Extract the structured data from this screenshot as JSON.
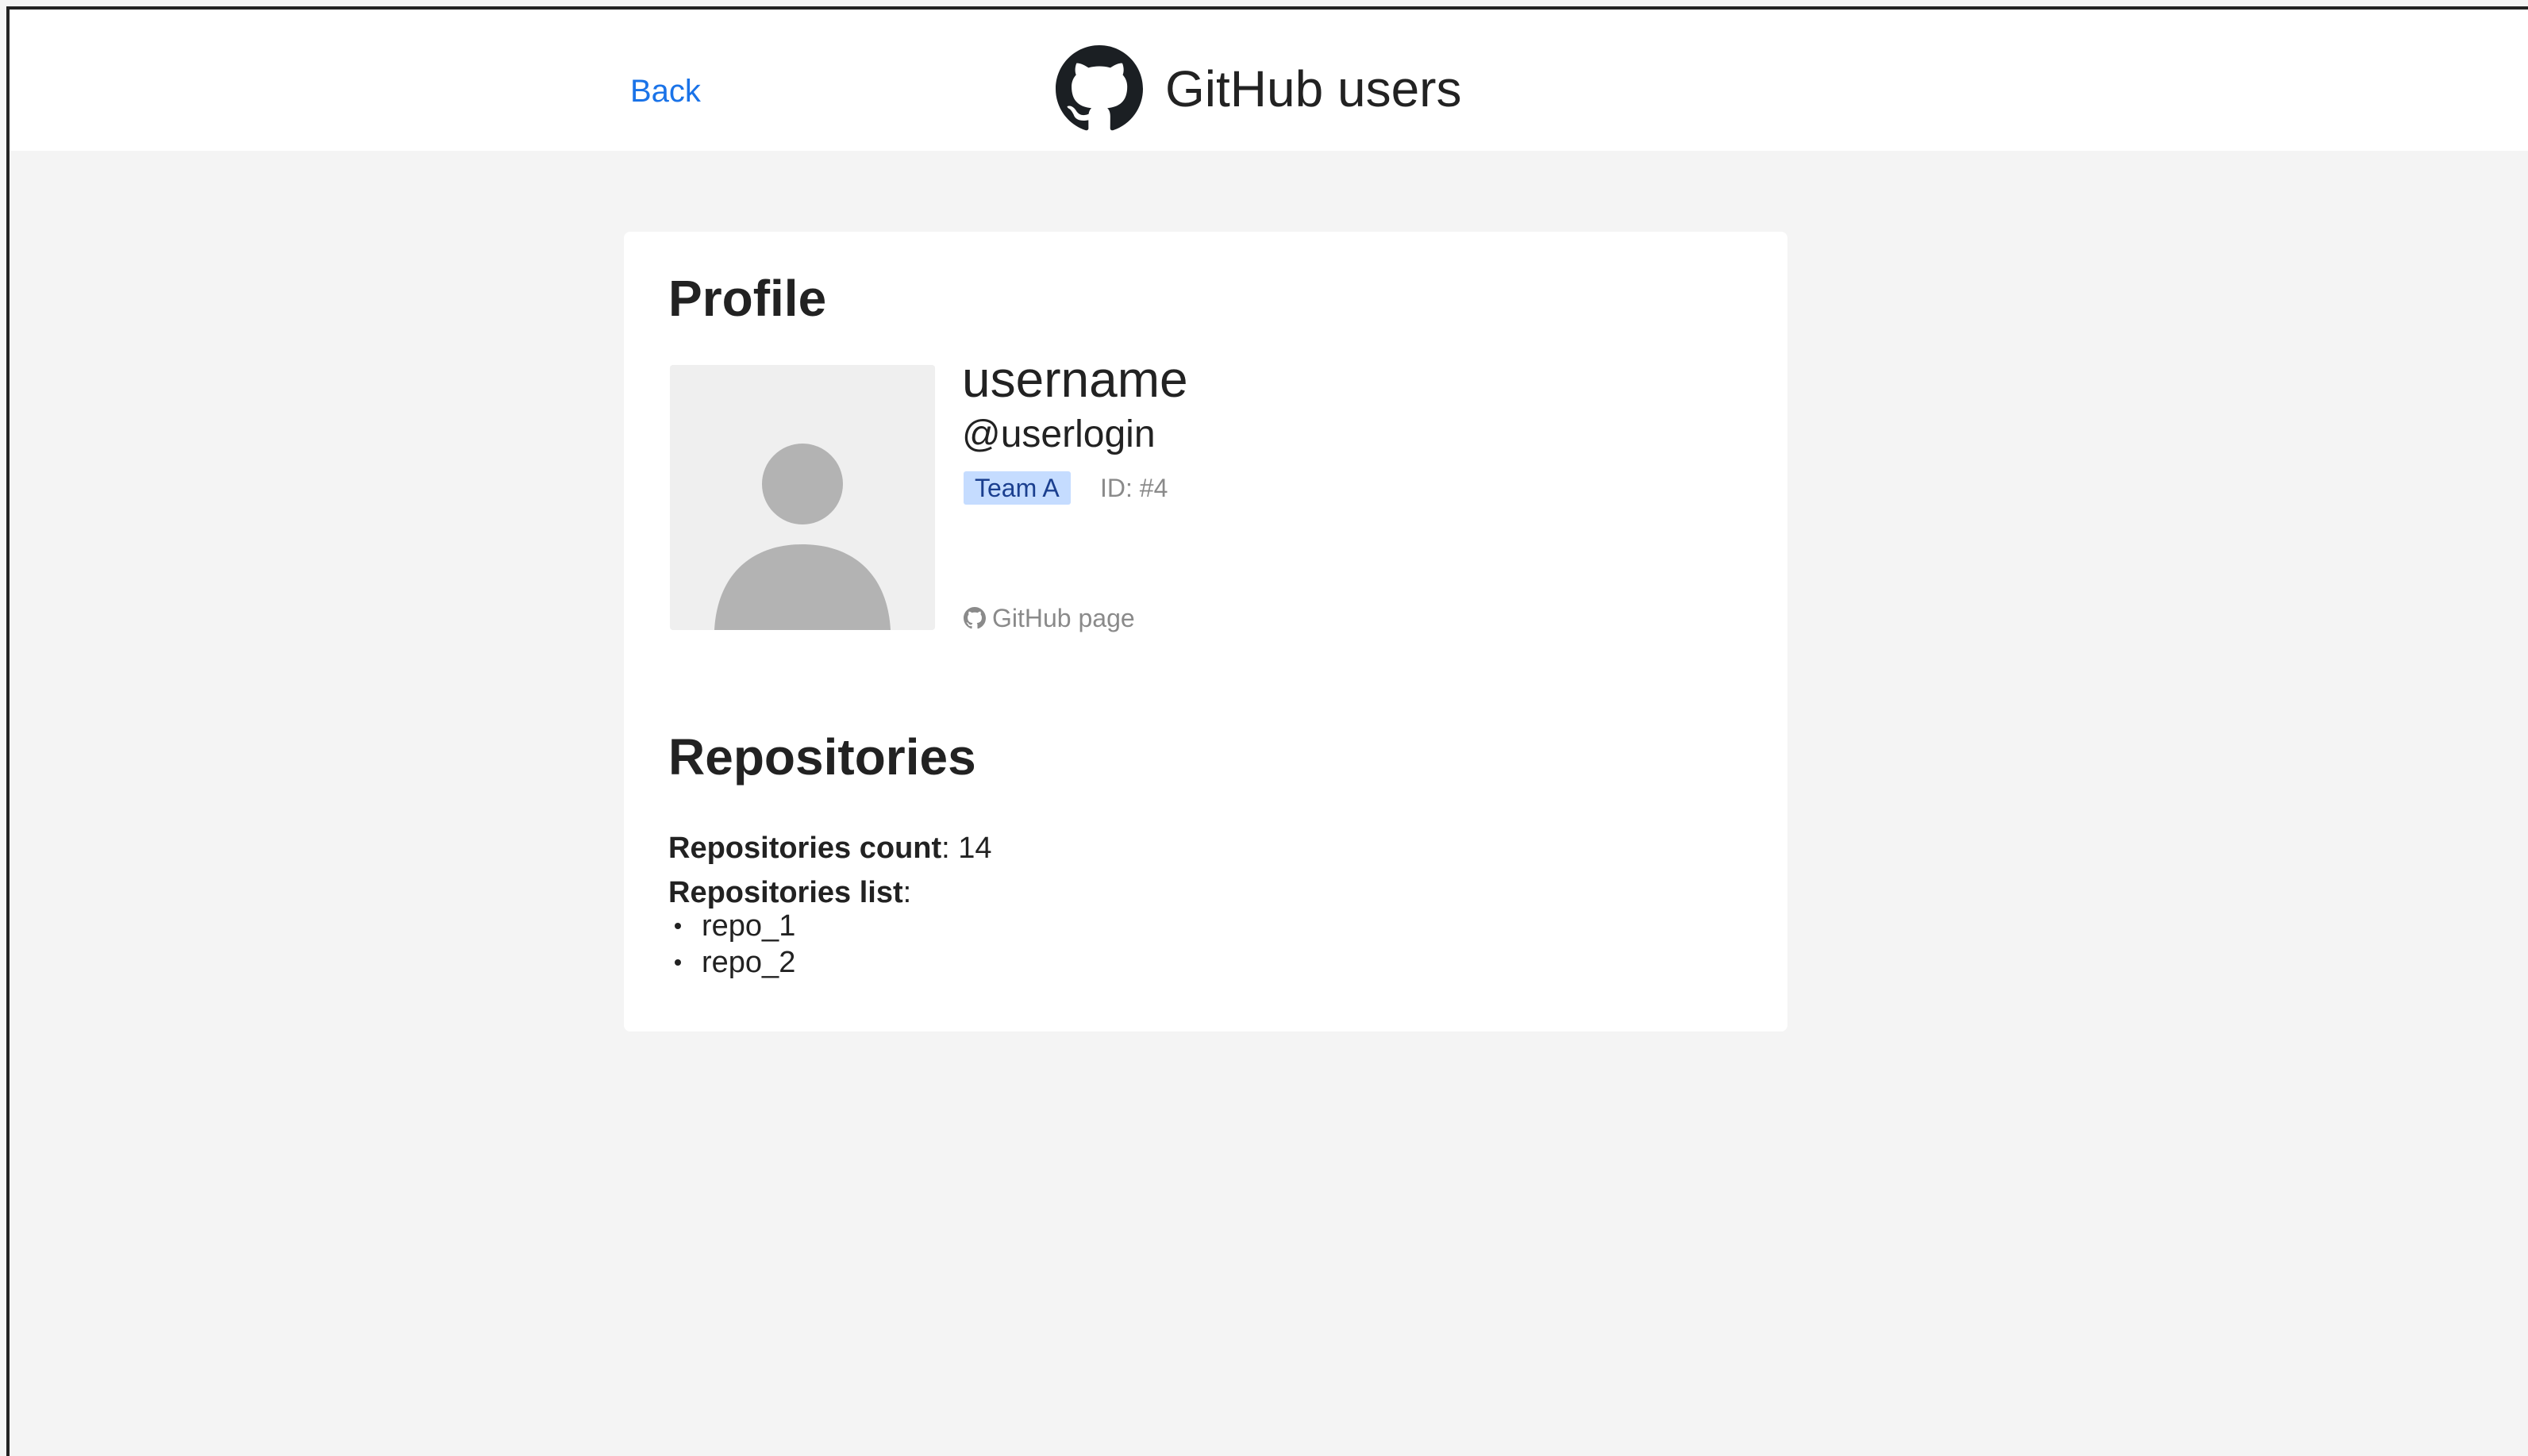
{
  "header": {
    "back_label": "Back",
    "title": "GitHub users",
    "logo_icon": "github-octocat-icon"
  },
  "profile": {
    "heading": "Profile",
    "avatar_icon": "default-user-avatar-icon",
    "name": "username",
    "login": "@userlogin",
    "team_badge": "Team A",
    "id_label": "ID: #4",
    "github_link_icon": "github-icon",
    "github_link_label": "GitHub page"
  },
  "repositories": {
    "heading": "Repositories",
    "count_label": "Repositories count",
    "count_value": "14",
    "list_label": "Repositories list",
    "items": [
      "repo_1",
      "repo_2"
    ]
  },
  "colors": {
    "link": "#1a73e8",
    "badge_bg": "#c5dcff",
    "badge_text": "#1b3f8f",
    "page_bg": "#f4f4f4"
  }
}
